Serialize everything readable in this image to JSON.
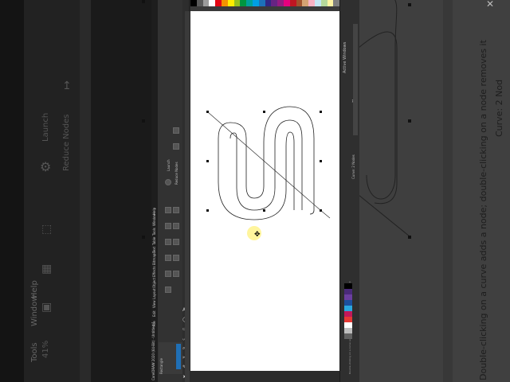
{
  "app": {
    "title": "CorelDRAW 2020 (64-Bit) - Untitled-1",
    "menu": [
      "File",
      "Edit",
      "View",
      "Layout",
      "Object",
      "Effects",
      "Bitmaps",
      "Text",
      "Table",
      "Tools",
      "Window",
      "Help"
    ],
    "property_bar": {
      "label_launch": "Launch",
      "label_reduce_nodes": "Reduce Nodes",
      "label_selection": "Rectangle"
    },
    "docker": {
      "title": "Active Windows",
      "status": "Curve: 2 Nodes"
    },
    "status_hint": "Double-clicking on a curve adds a node; double-clicking on a node removes it"
  },
  "background_left": {
    "menu_tools": "Tools",
    "menu_window": "Window",
    "menu_help": "Help",
    "label_launch": "Launch",
    "label_reduce_nodes": "Reduce Nodes",
    "zoom": "41%"
  },
  "background_right": {
    "hint": "Double-clicking on a curve adds a node; double-clicking on a node removes it",
    "status": "Curve: 2 Nod"
  },
  "colors": {
    "page": "#ffffff",
    "ui_dark": "#2b2b2b",
    "curve": "#222222",
    "cursor_highlight": "#fff59d"
  },
  "top_palette": [
    "#000000",
    "#5a5a5a",
    "#9c9c9c",
    "#ffffff",
    "#e30613",
    "#f39200",
    "#ffed00",
    "#95c11f",
    "#009640",
    "#00a19a",
    "#009fe3",
    "#1d71b8",
    "#312783",
    "#662483",
    "#951b81",
    "#e6007e",
    "#be1622",
    "#a0522d",
    "#d4a373",
    "#f7b2c4",
    "#c3e6f5",
    "#b5d99c",
    "#fff4a3",
    "#7f7f7f"
  ],
  "side_palette": [
    "#000000",
    "#4a2a7a",
    "#6b3fa0",
    "#1c4f9c",
    "#2aa7df",
    "#c2185b",
    "#e53935",
    "#ffffff",
    "#bdbdbd",
    "#616161"
  ]
}
